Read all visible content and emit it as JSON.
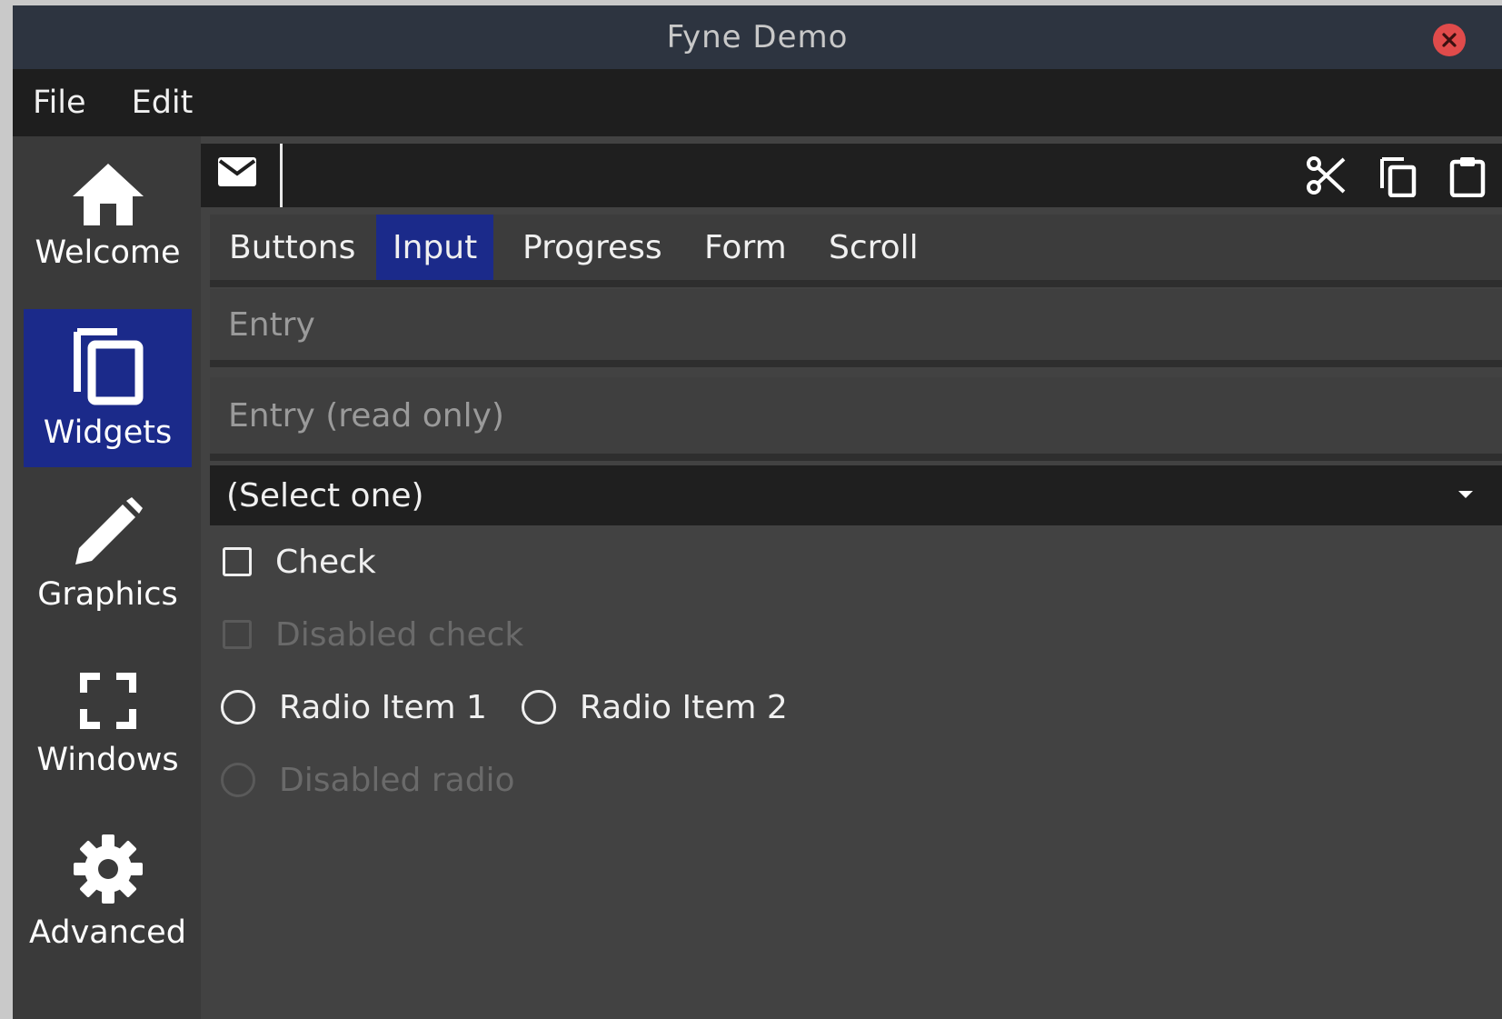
{
  "window": {
    "title": "Fyne Demo"
  },
  "menu": {
    "items": [
      "File",
      "Edit"
    ]
  },
  "sidebar": {
    "items": [
      {
        "label": "Welcome",
        "icon": "home-icon",
        "selected": false
      },
      {
        "label": "Widgets",
        "icon": "copy-icon",
        "selected": true
      },
      {
        "label": "Graphics",
        "icon": "pencil-icon",
        "selected": false
      },
      {
        "label": "Windows",
        "icon": "fullscreen-icon",
        "selected": false
      },
      {
        "label": "Advanced",
        "icon": "gear-icon",
        "selected": false
      }
    ]
  },
  "toolbar": {
    "icons": [
      "mail-icon",
      "cut-icon",
      "copy-icon",
      "paste-icon"
    ]
  },
  "tabs": {
    "items": [
      "Buttons",
      "Input",
      "Progress",
      "Form",
      "Scroll"
    ],
    "active": "Input"
  },
  "input": {
    "entry_placeholder": "Entry",
    "readonly_placeholder": "Entry (read only)",
    "select_value": "(Select one)",
    "check_label": "Check",
    "check_checked": false,
    "disabled_check_label": "Disabled check",
    "radio_items": [
      "Radio Item 1",
      "Radio Item 2"
    ],
    "disabled_radio_label": "Disabled radio"
  },
  "colors": {
    "accent": "#1b2a8a",
    "close_button": "#e04b4b",
    "background": "#424242"
  }
}
